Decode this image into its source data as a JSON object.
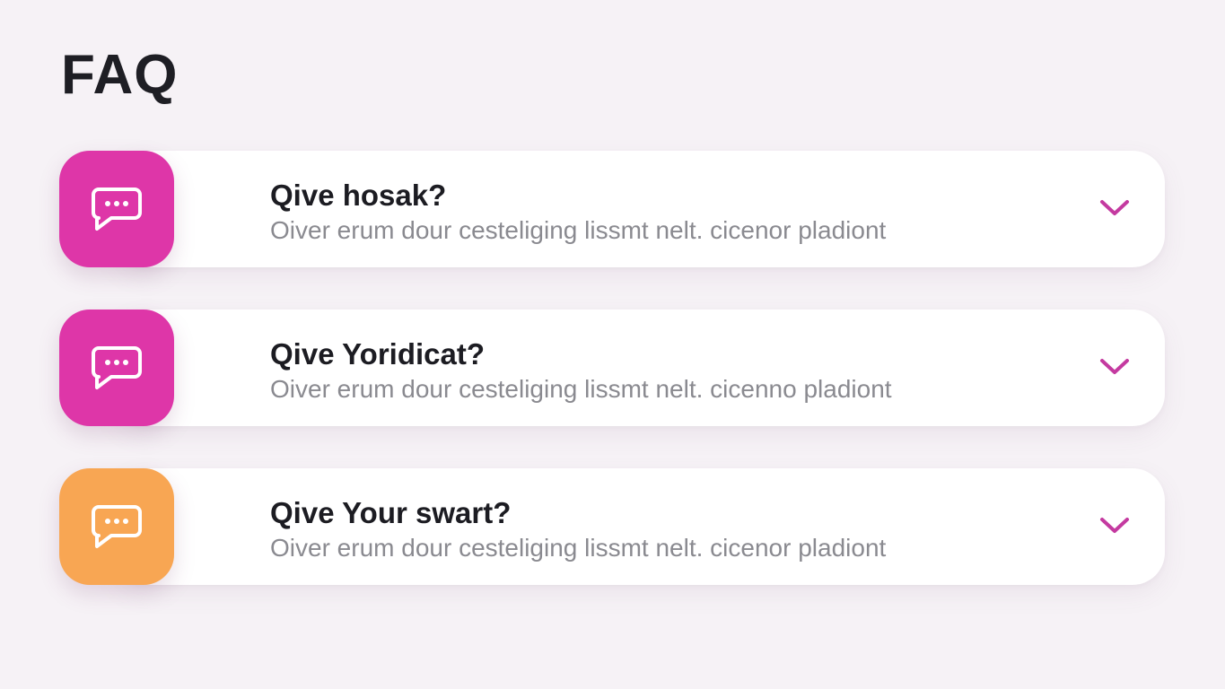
{
  "page": {
    "title": "FAQ"
  },
  "colors": {
    "accent_pink": "#de36a8",
    "accent_orange": "#f8a653",
    "chevron": "#c43aa0",
    "background": "#f6f2f6"
  },
  "faq": {
    "items": [
      {
        "icon": "chat-bubble-icon",
        "icon_color": "#de36a8",
        "question": "Qive hosak?",
        "answer": "Oiver erum dour cesteliging lissmt nelt. cicenor pladiont"
      },
      {
        "icon": "chat-bubble-icon",
        "icon_color": "#de36a8",
        "question": "Qive Yoridicat?",
        "answer": "Oiver erum dour cesteliging lissmt nelt. cicenno pladiont"
      },
      {
        "icon": "chat-bubble-icon",
        "icon_color": "#f8a653",
        "question": "Qive Your swart?",
        "answer": "Oiver erum dour cesteliging lissmt nelt. cicenor pladiont"
      }
    ]
  }
}
